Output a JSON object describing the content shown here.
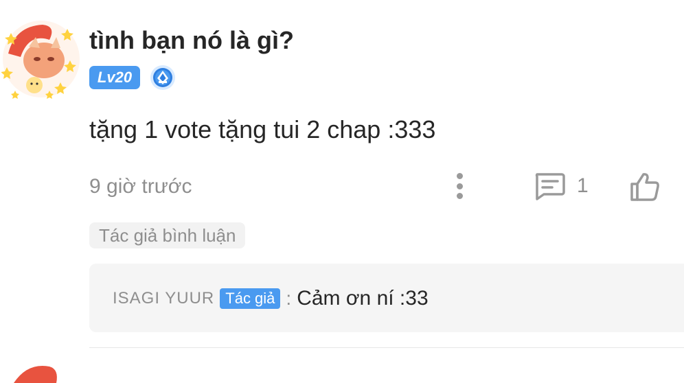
{
  "comment": {
    "username": "tình bạn nó là gì?",
    "level_badge": "Lv20",
    "medal_icon": "blue-medal-icon",
    "text": "tặng 1 vote tặng tui 2 chap :333",
    "timestamp": "9 giờ trước",
    "reply_count": "1",
    "author_reply_label": "Tác giả bình luận",
    "reply": {
      "author": "ISAGI YUUR",
      "author_badge": "Tác giả",
      "separator": ":",
      "text": "Cảm ơn ní :33"
    }
  },
  "colors": {
    "accent_blue": "#4a9af0",
    "muted_text": "#8e8e8e",
    "reply_bg": "#f5f5f5"
  }
}
